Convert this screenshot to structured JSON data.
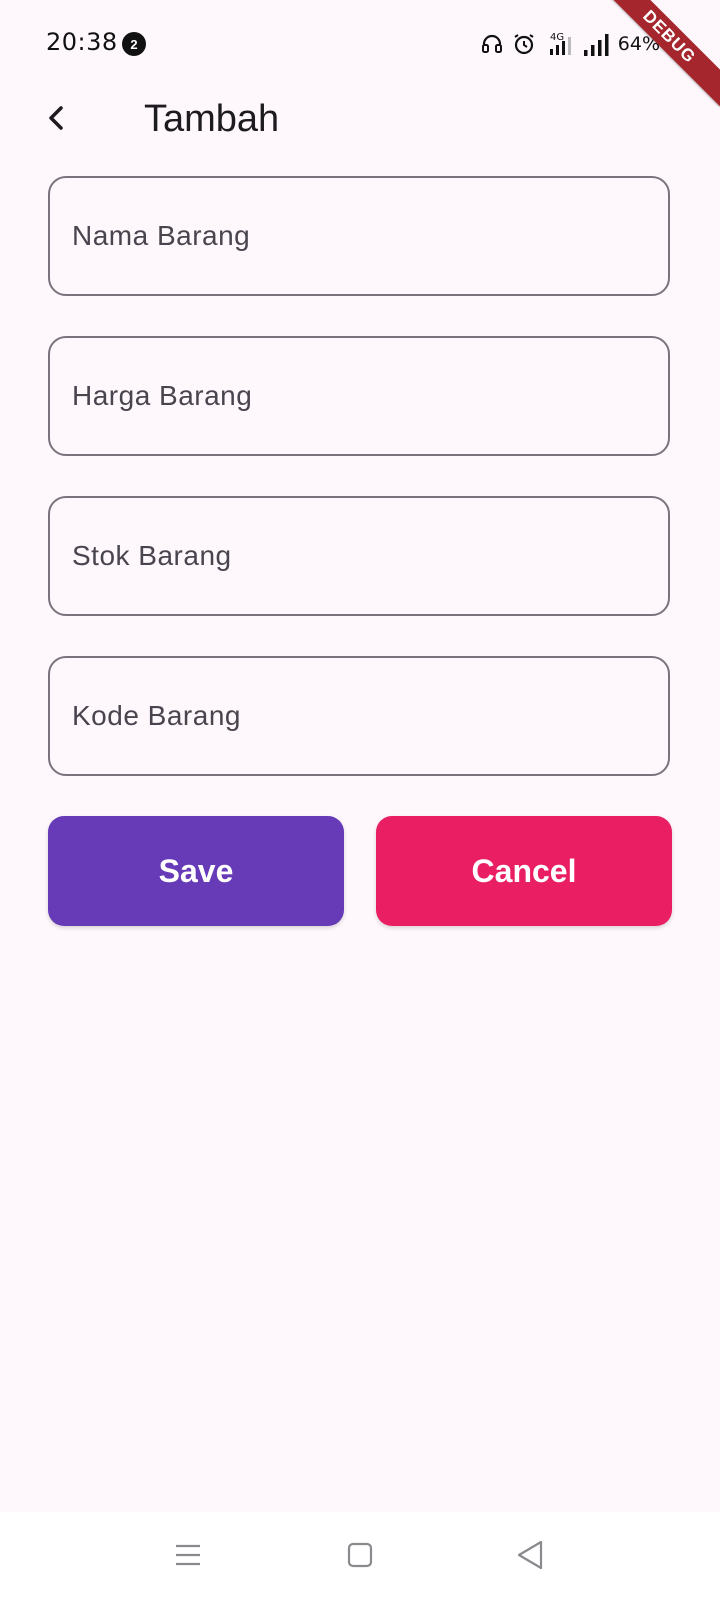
{
  "status_bar": {
    "time": "20:38",
    "notification_count": "2",
    "network": "4G",
    "battery": "64%",
    "debug_label": "DEBUG"
  },
  "app_bar": {
    "title": "Tambah",
    "back_icon": "chevron-left-icon"
  },
  "form": {
    "fields": [
      {
        "placeholder": "Nama Barang",
        "value": ""
      },
      {
        "placeholder": "Harga Barang",
        "value": ""
      },
      {
        "placeholder": "Stok Barang",
        "value": ""
      },
      {
        "placeholder": "Kode Barang",
        "value": ""
      }
    ],
    "save_label": "Save",
    "cancel_label": "Cancel"
  },
  "nav_bar": {
    "menu_icon": "menu-icon",
    "home_icon": "home-icon",
    "back_icon": "back-triangle-icon"
  },
  "colors": {
    "background": "#fef7fb",
    "save_button": "#673ab7",
    "cancel_button": "#e91e63",
    "field_border": "#79747e",
    "debug_banner": "#a5262d"
  }
}
